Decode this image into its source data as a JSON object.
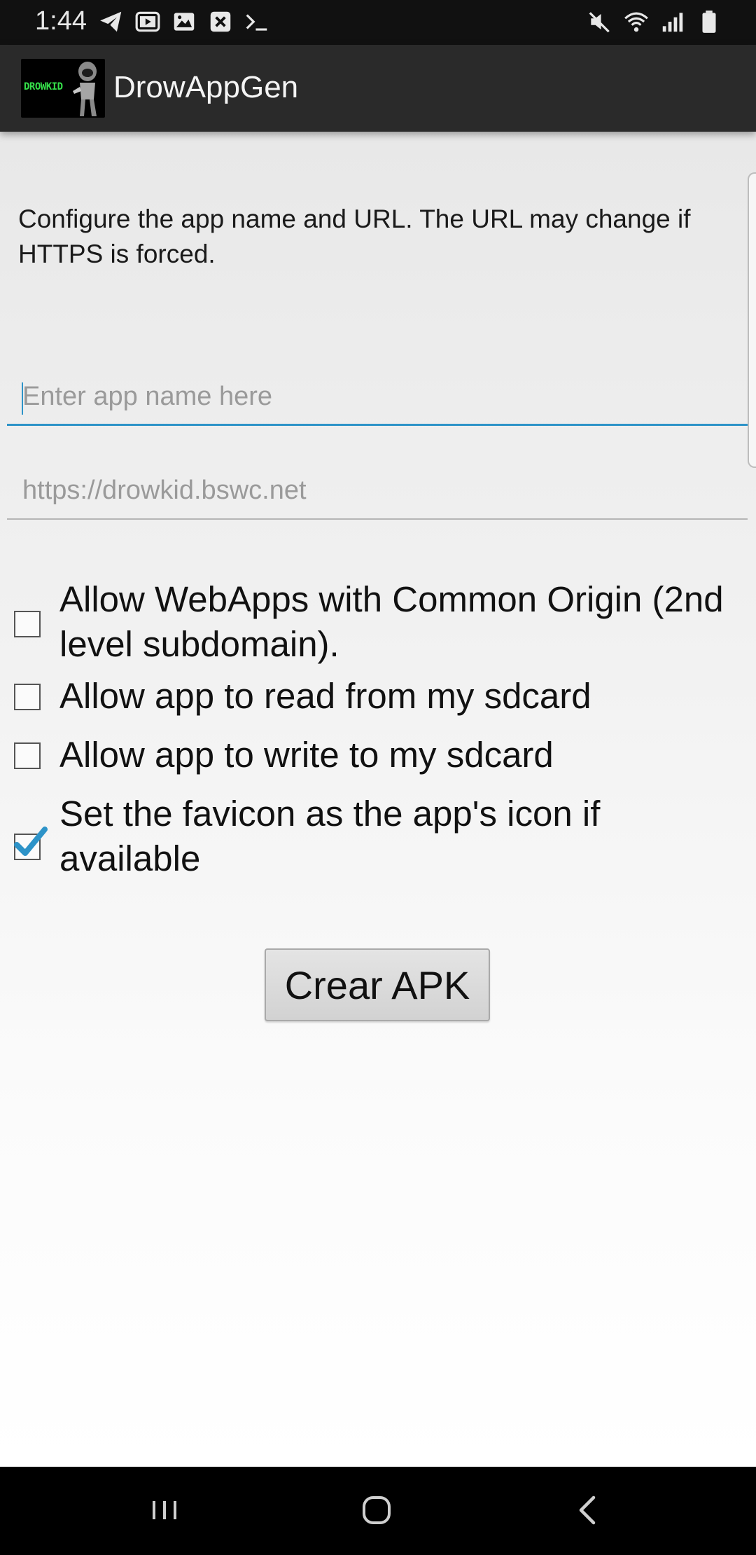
{
  "status_bar": {
    "time": "1:44",
    "left_icons": [
      "telegram-icon",
      "youtube-icon",
      "gallery-icon",
      "close-box-icon",
      "terminal-icon"
    ],
    "right_icons": [
      "mute-icon",
      "wifi-icon",
      "signal-icon",
      "battery-icon"
    ]
  },
  "app_bar": {
    "logo_text": "DROWKID",
    "title": "DrowAppGen"
  },
  "main": {
    "description": "Configure the app name and URL. The URL may change if HTTPS is forced.",
    "app_name_field": {
      "value": "",
      "placeholder": "Enter app name here"
    },
    "url_field": {
      "value": "",
      "placeholder": "https://drowkid.bswc.net"
    },
    "options": [
      {
        "label": "Allow WebApps with Common Origin (2nd level subdomain).",
        "checked": false
      },
      {
        "label": "Allow app to read from my sdcard",
        "checked": false
      },
      {
        "label": "Allow app to write to my sdcard",
        "checked": false
      },
      {
        "label": "Set the favicon as the app's icon if available",
        "checked": true
      }
    ],
    "create_button_label": "Crear APK"
  },
  "nav_bar": {
    "buttons": [
      "recents-icon",
      "home-icon",
      "back-icon"
    ]
  },
  "colors": {
    "accent": "#2d93c8",
    "app_bar": "#2a2a2a",
    "status_bar": "#111111"
  }
}
